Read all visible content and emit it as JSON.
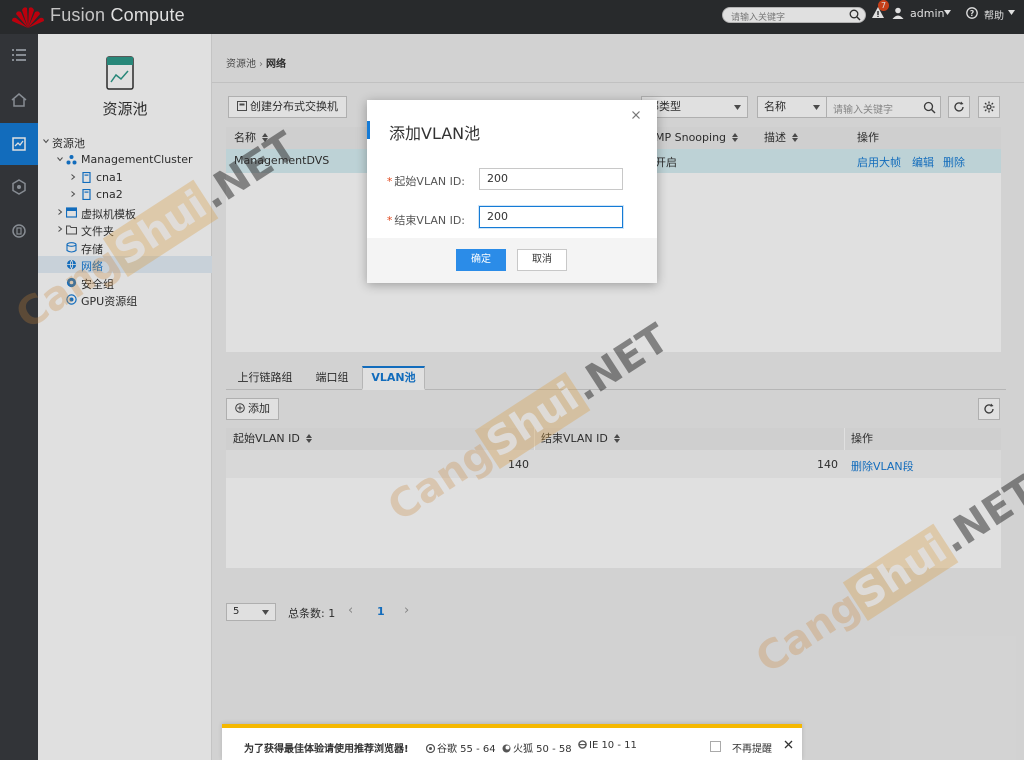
{
  "app": {
    "brand_prefix": "Fusion",
    "brand_suffix": "Compute",
    "search_placeholder": "请输入关键字",
    "alert_count": "7",
    "user": "admin",
    "help": "帮助"
  },
  "tree": {
    "title": "资源池",
    "items": [
      {
        "label": "资源池"
      },
      {
        "label": "ManagementCluster"
      },
      {
        "label": "cna1"
      },
      {
        "label": "cna2"
      },
      {
        "label": "虚拟机模板"
      },
      {
        "label": "文件夹"
      },
      {
        "label": "存储"
      },
      {
        "label": "网络"
      },
      {
        "label": "安全组"
      },
      {
        "label": "GPU资源组"
      }
    ]
  },
  "breadcrumb": {
    "parent": "资源池",
    "sep": "›",
    "current": "网络"
  },
  "toolbar": {
    "create_label": "创建分布式交换机",
    "type_select": "部类型",
    "name_select": "名称",
    "search_placeholder": "请输入关键字"
  },
  "dvs_table": {
    "headers": [
      "名称",
      "MP Snooping",
      "描述",
      "操作"
    ],
    "rows": [
      {
        "name": "ManagementDVS",
        "snooping": "开启",
        "actions": [
          "启用大帧",
          "编辑",
          "删除"
        ]
      }
    ]
  },
  "tabs": [
    "上行链路组",
    "端口组",
    "VLAN池"
  ],
  "vlan_section": {
    "add_label": "添加",
    "headers": [
      "起始VLAN ID",
      "结束VLAN ID",
      "操作"
    ],
    "rows": [
      {
        "start": "140",
        "end": "140",
        "action": "删除VLAN段"
      }
    ]
  },
  "pager": {
    "page_size": "5",
    "total_label": "总条数: 1",
    "prev": "‹",
    "current_page": "1",
    "next": "›"
  },
  "dialog": {
    "title": "添加VLAN池",
    "required_mark": "*",
    "start_label": "起始VLAN ID:",
    "start_value": "200",
    "end_label": "结束VLAN ID:",
    "end_value": "200",
    "ok": "确定",
    "cancel": "取消"
  },
  "notice": {
    "text": "为了获得最佳体验请使用推荐浏览器!",
    "chrome": "谷歌 55 - 64",
    "firefox": "火狐 50 - 58",
    "ie": "IE 10 - 11",
    "dismiss": "不再提醒"
  },
  "watermark": {
    "a": "Cang",
    "b": "Shui",
    "c": ".NET"
  },
  "colors": {
    "accent": "#157bd6",
    "topbar": "#2e3033",
    "rail": "#3a3c40",
    "selected_row": "#d8f0f4",
    "warning_bar": "#f5b800",
    "badge": "#e2481d"
  }
}
